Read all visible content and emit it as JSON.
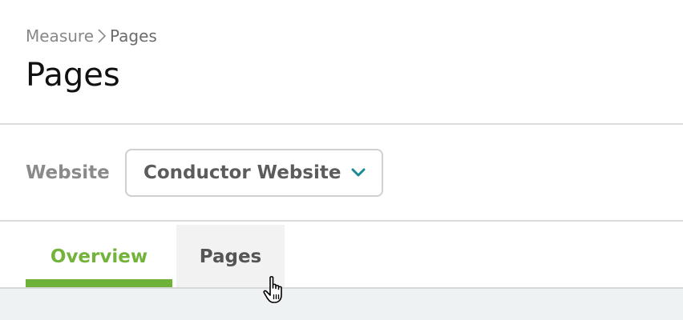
{
  "breadcrumb": {
    "parent": "Measure",
    "current": "Pages",
    "separator_icon": "chevron-right-icon"
  },
  "page": {
    "title": "Pages"
  },
  "website": {
    "label": "Website",
    "selected": "Conductor Website",
    "dropdown_icon": "chevron-down-icon",
    "accent_color": "#1a8a95"
  },
  "tabs": [
    {
      "label": "Overview",
      "active": true,
      "color": "#74b33b"
    },
    {
      "label": "Pages",
      "active": false,
      "hovered": true
    }
  ],
  "cursor": {
    "icon": "hand-pointer-icon"
  }
}
